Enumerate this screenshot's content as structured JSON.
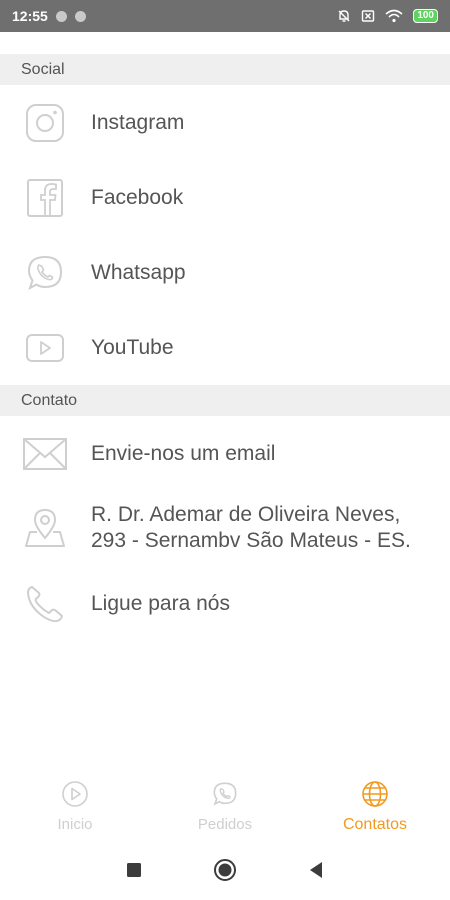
{
  "status_bar": {
    "time": "12:55",
    "battery": "100"
  },
  "sections": {
    "social": {
      "header": "Social",
      "items": [
        {
          "label": "Instagram",
          "icon": "instagram-icon"
        },
        {
          "label": "Facebook",
          "icon": "facebook-icon"
        },
        {
          "label": "Whatsapp",
          "icon": "whatsapp-icon"
        },
        {
          "label": "YouTube",
          "icon": "youtube-icon"
        }
      ]
    },
    "contato": {
      "header": "Contato",
      "items": [
        {
          "label": "Envie-nos um email",
          "icon": "mail-icon"
        },
        {
          "label_line1": "R. Dr. Ademar de Oliveira Neves,",
          "label_line2": "293 - Sernambv São Mateus - ES.",
          "icon": "location-pin-icon"
        },
        {
          "label": "Ligue para nós",
          "icon": "phone-icon"
        }
      ]
    }
  },
  "bottom_nav": {
    "items": [
      {
        "label": "Inicio",
        "icon": "play-icon",
        "active": false
      },
      {
        "label": "Pedidos",
        "icon": "whatsapp-icon",
        "active": false
      },
      {
        "label": "Contatos",
        "icon": "globe-icon",
        "active": true
      }
    ]
  },
  "colors": {
    "accent": "#f09a1f",
    "inactive": "#cfcfcf",
    "section_bg": "#efefef",
    "status_bar": "#6f6f6f"
  }
}
